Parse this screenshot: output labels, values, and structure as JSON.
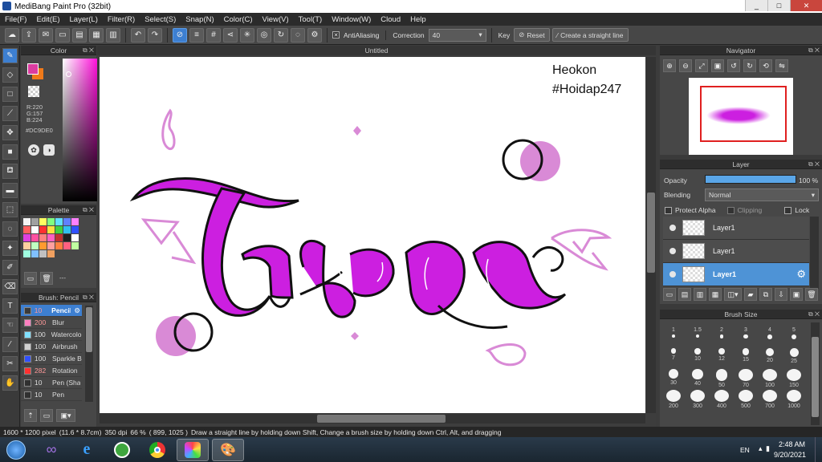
{
  "window": {
    "title": "MediBang Paint Pro (32bit)",
    "minimize": "_",
    "maximize": "□",
    "close": "✕"
  },
  "menu": [
    "File(F)",
    "Edit(E)",
    "Layer(L)",
    "Filter(R)",
    "Select(S)",
    "Snap(N)",
    "Color(C)",
    "View(V)",
    "Tool(T)",
    "Window(W)",
    "Cloud",
    "Help"
  ],
  "toolbar": {
    "antialias_label": "AntiAliasing",
    "correction_label": "Correction",
    "correction_value": "40",
    "key_label": "Key",
    "reset_label": "Reset",
    "straight_line_label": "Create a straight line"
  },
  "color_panel": {
    "title": "Color",
    "r": "R:220",
    "g": "G:157",
    "b": "B:224",
    "hex": "#DC9DE0",
    "primary_color": "#dc3ca0",
    "secondary_color": "#f07a1a"
  },
  "palette_panel": {
    "title": "Palette",
    "dash": "---",
    "colors": [
      "#f5f5f5",
      "#a0a0a0",
      "#ffff60",
      "#80ff80",
      "#60e0ff",
      "#6080ff",
      "#ff80ff",
      "#ff6060",
      "#ffffff",
      "#ff3030",
      "#ffe040",
      "#40d040",
      "#30c0f0",
      "#3050ff",
      "#e040e0",
      "#ff50a0",
      "#ff8080",
      "#ff60c0",
      "#c03030",
      "#202020",
      "#ffffff",
      "#ffd0a0",
      "#c0ffc0",
      "#ff9a30",
      "#ffa0a0",
      "#ff8040",
      "#ff6080",
      "#c0ffa0",
      "#a0ffe0",
      "#80c0ff",
      "#c0c0c0",
      "#f0a060"
    ]
  },
  "brush_panel": {
    "title": "Brush: Pencil",
    "items": [
      {
        "size": "10",
        "name": "Pencil",
        "color": "#3a3a3a",
        "active": true
      },
      {
        "size": "200",
        "name": "Blur",
        "color": "#ff80c0",
        "active": false
      },
      {
        "size": "100",
        "name": "Watercolor",
        "color": "#80e0ff",
        "active": false
      },
      {
        "size": "100",
        "name": "Airbrush",
        "color": "#d0d0d0",
        "active": false
      },
      {
        "size": "100",
        "name": "Sparkle B",
        "color": "#3050ff",
        "active": false
      },
      {
        "size": "282",
        "name": "Rotation",
        "color": "#ff3030",
        "active": false
      },
      {
        "size": "10",
        "name": "Pen (Sha",
        "color": "#303030",
        "active": false
      },
      {
        "size": "10",
        "name": "Pen",
        "color": "#303030",
        "active": false
      }
    ]
  },
  "canvas": {
    "tab_title": "Untitled",
    "watermark_line1": "Heokon",
    "watermark_line2": "#Hoidap247"
  },
  "navigator": {
    "title": "Navigator"
  },
  "layer_panel": {
    "title": "Layer",
    "opacity_label": "Opacity",
    "opacity_value": "100 %",
    "opacity_fraction": 1.0,
    "blending_label": "Blending",
    "blending_value": "Normal",
    "protect_alpha": "Protect Alpha",
    "clipping": "Clipping",
    "lock": "Lock",
    "layers": [
      {
        "name": "Layer1",
        "active": false
      },
      {
        "name": "Layer1",
        "active": false
      },
      {
        "name": "Layer1",
        "active": true
      }
    ]
  },
  "brush_size_panel": {
    "title": "Brush Size",
    "sizes": [
      "1",
      "1.5",
      "2",
      "3",
      "4",
      "5",
      "7",
      "10",
      "12",
      "15",
      "20",
      "25",
      "30",
      "40",
      "50",
      "70",
      "100",
      "150",
      "200",
      "300",
      "400",
      "500",
      "700",
      "1000"
    ]
  },
  "status": {
    "pixel_size": "1600 * 1200 pixel",
    "cm_size": "(11.6 * 8.7cm)",
    "dpi": "350 dpi",
    "zoom": "66 %",
    "coords": "( 899, 1025 )",
    "hint": "Draw a straight line by holding down Shift, Change a brush size by holding down Ctrl, Alt, and dragging"
  },
  "taskbar": {
    "lang": "EN",
    "time": "2:48 AM",
    "date": "9/20/2021"
  }
}
